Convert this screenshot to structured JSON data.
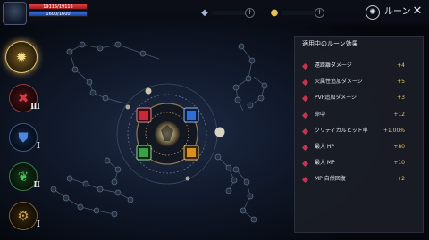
{
  "player": {
    "hp_text": "19115/19115",
    "mp_text": "1600/1600",
    "hp_fraction": 1.0,
    "mp_fraction": 1.0
  },
  "currencies": [
    {
      "icon": "crystal-icon",
      "plus": "+"
    },
    {
      "icon": "coin-icon",
      "plus": "+"
    }
  ],
  "header": {
    "title": "ルーン",
    "close": "✕"
  },
  "rune_slots": [
    {
      "icon": "sun-rune-icon",
      "level": "",
      "color": "#d9b35a"
    },
    {
      "icon": "sword-rune-icon",
      "level": "Ⅲ",
      "color": "#b8303a"
    },
    {
      "icon": "shield-rune-icon",
      "level": "Ⅰ",
      "color": "#3c6ec8"
    },
    {
      "icon": "leaf-rune-icon",
      "level": "Ⅱ",
      "color": "#3aa04a"
    },
    {
      "icon": "gear-rune-icon",
      "level": "Ⅰ",
      "color": "#b98a3a"
    }
  ],
  "panel": {
    "title": "適用中のルーン効果",
    "effects": [
      {
        "name": "遠距離ダメージ",
        "value": "+4"
      },
      {
        "name": "火属性追加ダメージ",
        "value": "+5"
      },
      {
        "name": "PVP追加ダメージ",
        "value": "+3"
      },
      {
        "name": "命中",
        "value": "+12"
      },
      {
        "name": "クリティカルヒット率",
        "value": "+1.00%"
      },
      {
        "name": "最大 HP",
        "value": "+80"
      },
      {
        "name": "最大 MP",
        "value": "+10"
      },
      {
        "name": "MP 自然回復",
        "value": "+2"
      }
    ]
  },
  "colors": {
    "accent_gold": "#f0c453",
    "effect_bullet": "#c8324a",
    "hp": "#e14141",
    "mp": "#3e77e6"
  }
}
